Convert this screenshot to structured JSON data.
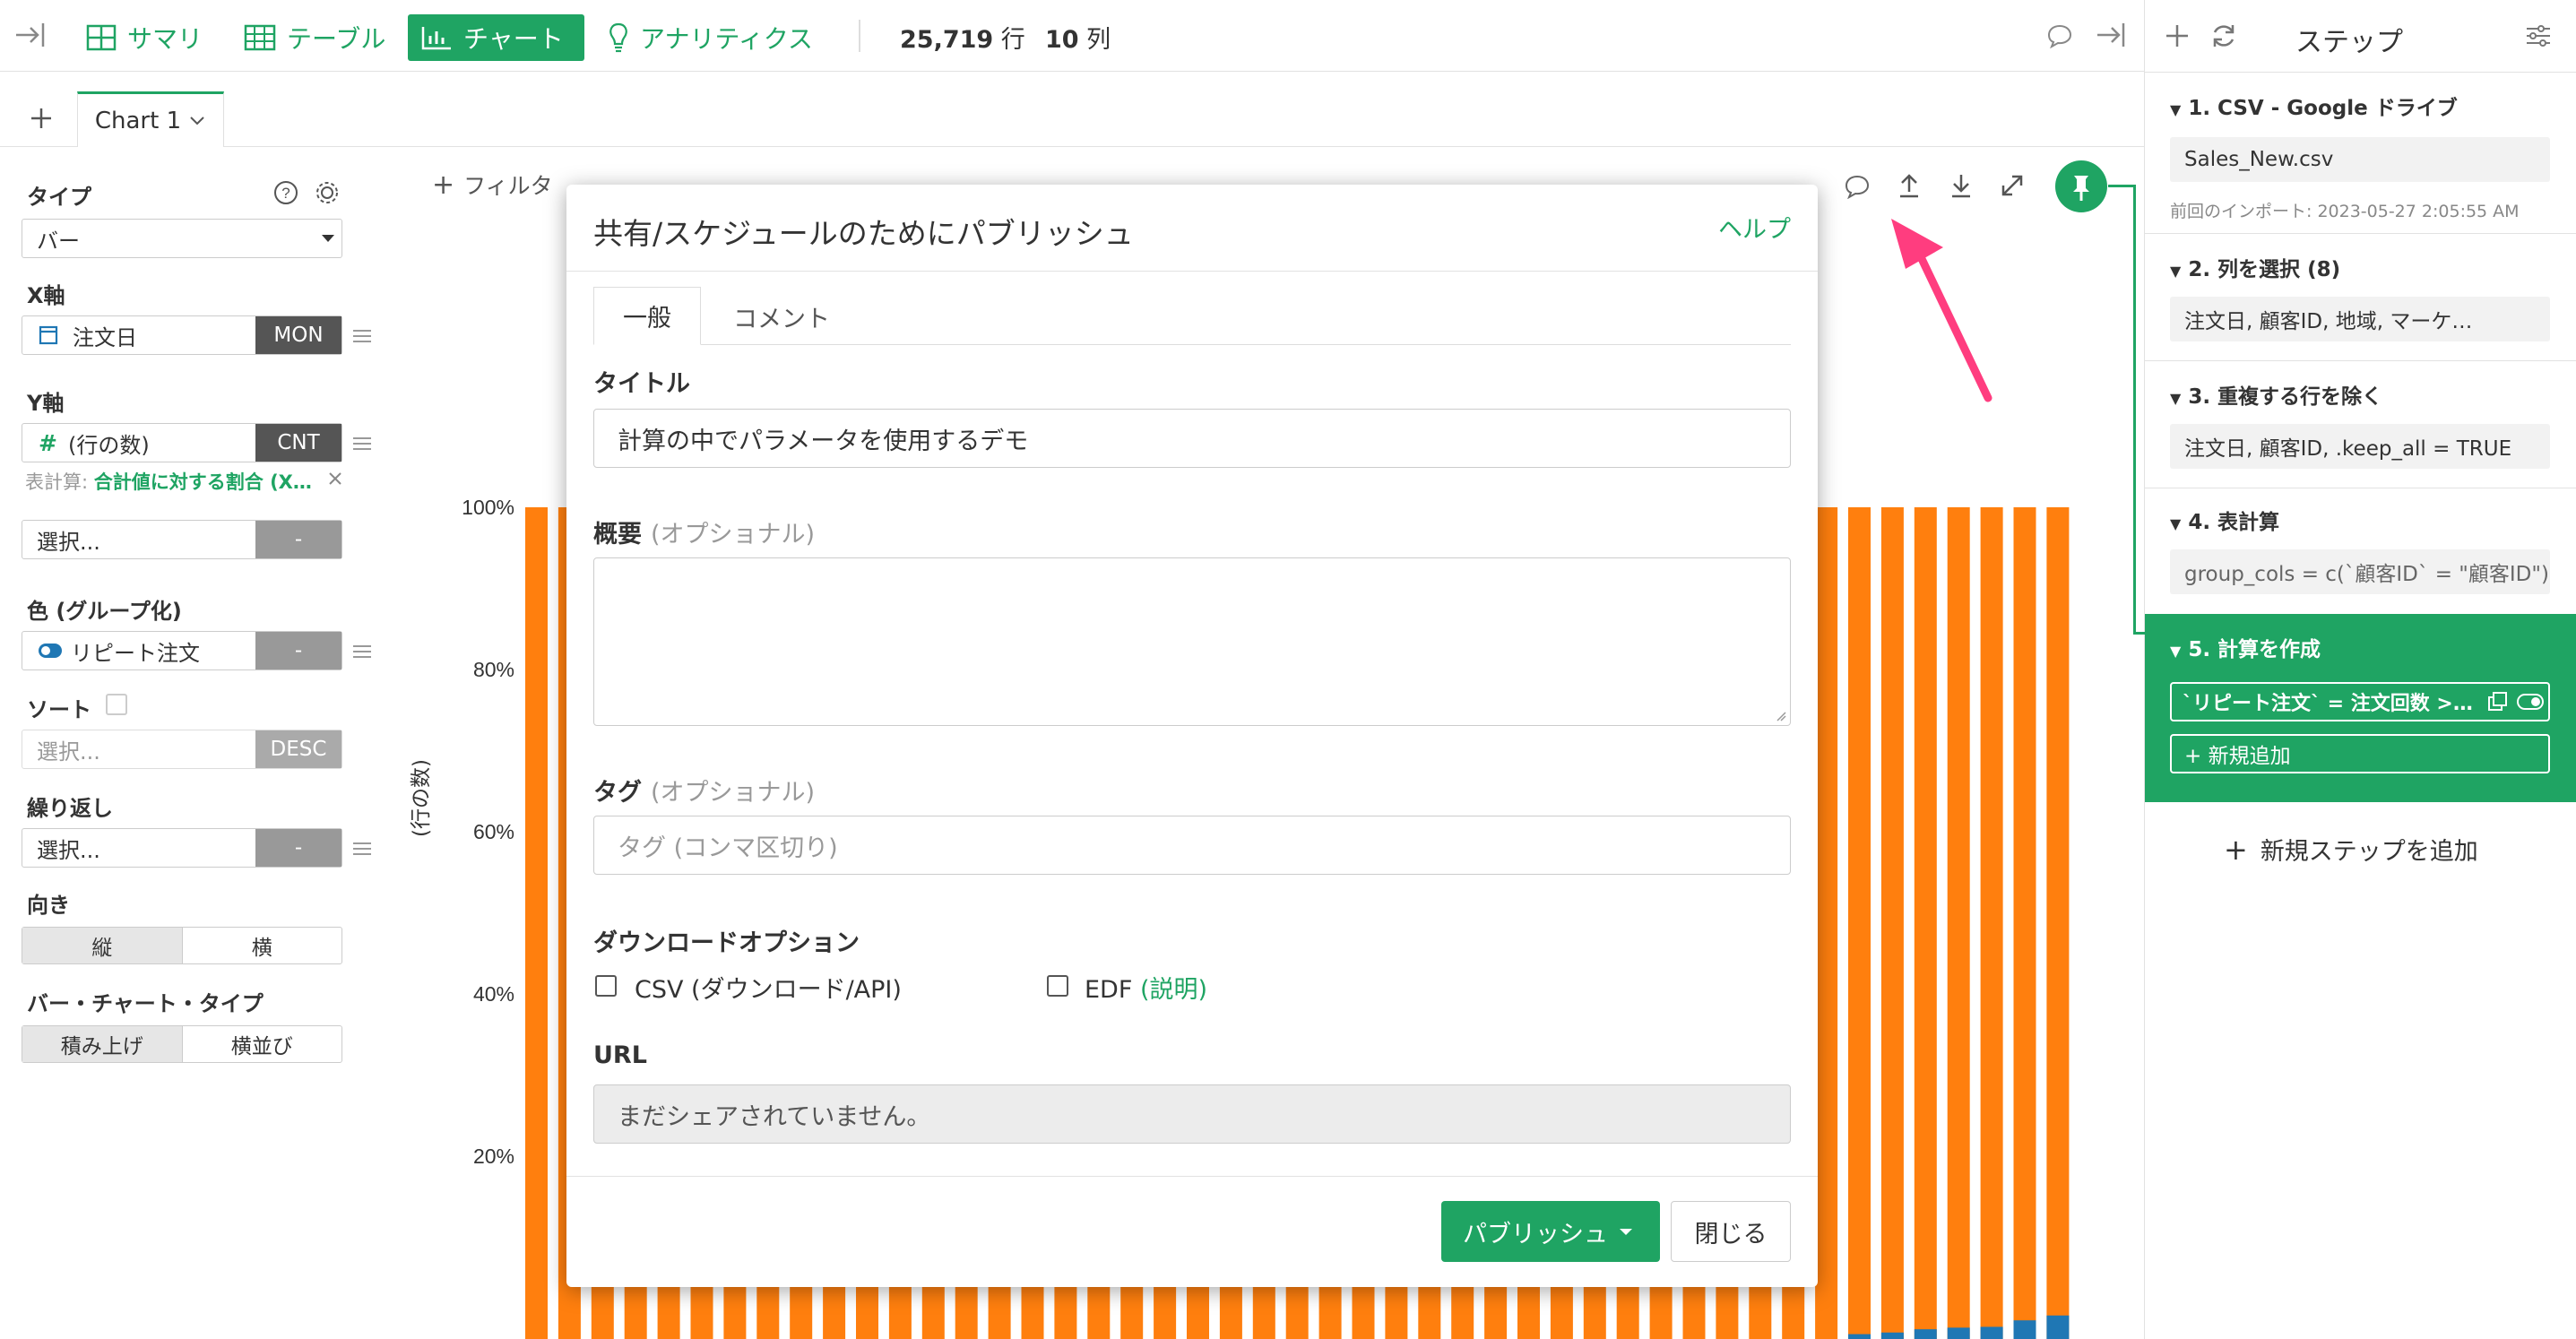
{
  "topbar": {
    "nav": [
      {
        "label": "サマリ",
        "icon": "summary-icon"
      },
      {
        "label": "テーブル",
        "icon": "table-icon"
      },
      {
        "label": "チャート",
        "icon": "chart-icon"
      },
      {
        "label": "アナリティクス",
        "icon": "lightbulb-icon"
      }
    ],
    "rows_value": "25,719",
    "rows_unit": "行",
    "cols_value": "10",
    "cols_unit": "列"
  },
  "tabs": {
    "chart_tab": "Chart 1"
  },
  "left": {
    "type_label": "タイプ",
    "type_value": "バー",
    "x_label": "X軸",
    "x_field": "注文日",
    "x_agg": "MON",
    "y_label": "Y軸",
    "y_field": "(行の数)",
    "y_agg": "CNT",
    "calc_prefix": "表計算:",
    "calc_value": "合計値に対する割合 (X…",
    "select_placeholder": "選択...",
    "dash": "-",
    "color_label": "色 (グループ化)",
    "color_field": "リピート注文",
    "sort_label": "ソート",
    "sort_placeholder": "選択...",
    "sort_order": "DESC",
    "repeat_label": "繰り返し",
    "repeat_placeholder": "選択...",
    "orientation_label": "向き",
    "orientation_options": [
      "縦",
      "横"
    ],
    "bartype_label": "バー・チャート・タイプ",
    "bartype_options": [
      "積み上げ",
      "横並び"
    ]
  },
  "chart": {
    "filter_label": "フィルタ",
    "y_axis_title": "(行の数)"
  },
  "chart_data": {
    "type": "bar",
    "stacked": true,
    "ylabel": "(行の数)",
    "y_ticks": [
      "20%",
      "40%",
      "60%",
      "80%",
      "100%"
    ],
    "ylim_visible": [
      0.1,
      1.0
    ],
    "colors": {
      "orange": "#ff7f0e",
      "blue": "#1f77b4"
    },
    "series": [
      {
        "color": "orange",
        "values": [
          1.0,
          1.0,
          1.0,
          1.0,
          1.0,
          1.0,
          1.0,
          1.0,
          1.0,
          1.0,
          1.0,
          1.0,
          1.0,
          1.0,
          1.0,
          1.0,
          1.0,
          1.0,
          1.0,
          1.0,
          1.0,
          1.0,
          1.0,
          1.0,
          1.0,
          1.0,
          1.0,
          1.0,
          1.0,
          1.0,
          1.0,
          1.0,
          1.0,
          1.0,
          1.0,
          1.0,
          1.0,
          1.0,
          1.0,
          1.0,
          0.994,
          0.992,
          0.988,
          0.986,
          0.985,
          0.977,
          0.971,
          0.965,
          0.952
        ]
      },
      {
        "color": "blue",
        "values": [
          0,
          0,
          0,
          0,
          0,
          0,
          0,
          0,
          0,
          0,
          0,
          0,
          0,
          0,
          0,
          0,
          0,
          0,
          0,
          0,
          0,
          0,
          0,
          0,
          0,
          0,
          0,
          0,
          0,
          0,
          0,
          0,
          0,
          0,
          0,
          0,
          0,
          0,
          0,
          0,
          0.006,
          0.008,
          0.012,
          0.014,
          0.015,
          0.023,
          0.029,
          0.035,
          0.048
        ]
      }
    ]
  },
  "modal": {
    "title": "共有/スケジュールのためにパブリッシュ",
    "help": "ヘルプ",
    "tabs": [
      "一般",
      "コメント"
    ],
    "title_label": "タイトル",
    "title_value": "計算の中でパラメータを使用するデモ",
    "summary_label": "概要",
    "optional": "(オプショナル)",
    "tag_label": "タグ",
    "tag_placeholder": "タグ (コンマ区切り)",
    "download_label": "ダウンロードオプション",
    "csv_label": "CSV (ダウンロード/API)",
    "edf_label": "EDF",
    "edf_link": "(説明)",
    "url_label": "URL",
    "url_value": "まだシェアされていません。",
    "publish_button": "パブリッシュ",
    "close_button": "閉じる"
  },
  "steps": {
    "header": "ステップ",
    "items": [
      {
        "title": "1. CSV - Google ドライブ",
        "box": "Sales_New.csv",
        "note": "前回のインポート: 2023-05-27 2:05:55 AM"
      },
      {
        "title": "2. 列を選択 (8)",
        "box": "注文日, 顧客ID, 地域, マーケ…"
      },
      {
        "title": "3. 重複する行を除く",
        "box": "注文日, 顧客ID, .keep_all = TRUE"
      },
      {
        "title": "4. 表計算",
        "box": "group_cols = c(`顧客ID` = \"顧客ID\"),…"
      },
      {
        "title": "5. 計算を作成",
        "box": "`リピート注文` = 注文回数 >…",
        "add": "+ 新規追加"
      }
    ],
    "add_step": "新規ステップを追加"
  }
}
